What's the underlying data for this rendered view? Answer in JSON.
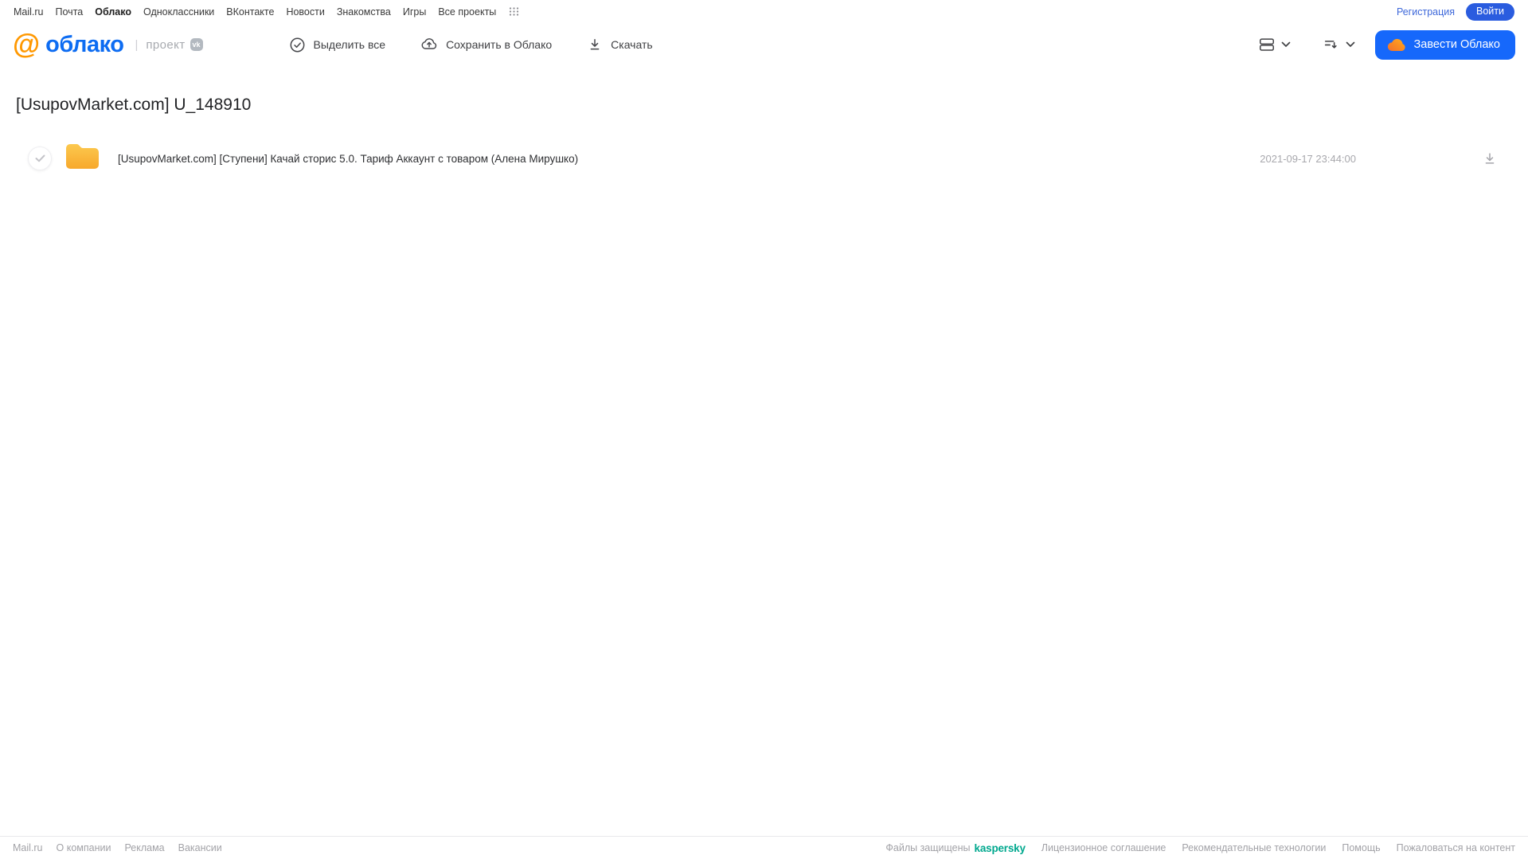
{
  "colors": {
    "brand_orange": "#ff9800",
    "brand_blue": "#0d6cf2",
    "accent_blue": "#1668fb",
    "login_blue": "#2a5cdf",
    "kaspersky_green": "#00a88e",
    "folder_yellow_top": "#fcc94f",
    "folder_yellow_bottom": "#f7a82c"
  },
  "topnav": {
    "items": [
      "Mail.ru",
      "Почта",
      "Облако",
      "Одноклассники",
      "ВКонтакте",
      "Новости",
      "Знакомства",
      "Игры",
      "Все проекты"
    ],
    "active_item": "Облако",
    "register": "Регистрация",
    "login": "Войти"
  },
  "appbar": {
    "logo_at": "@",
    "logo_text": "облако",
    "project_label": "проект",
    "vk_badge": "vk",
    "toolbar": {
      "select_all": "Выделить все",
      "save_to_cloud": "Сохранить в Облако",
      "download": "Скачать"
    },
    "get_cloud_button": "Завести Облако"
  },
  "main": {
    "title": "[UsupovMarket.com] U_148910",
    "files": [
      {
        "type": "folder",
        "name": "[UsupovMarket.com] [Ступени] Качай сторис 5.0. Тариф Аккаунт с товаром (Алена Мирушко)",
        "modified": "2021-09-17 23:44:00"
      }
    ]
  },
  "footer": {
    "left_links": [
      "Mail.ru",
      "О компании",
      "Реклама",
      "Вакансии"
    ],
    "protected_label": "Файлы защищены",
    "kaspersky": "kaspersky",
    "right_links": [
      "Лицензионное соглашение",
      "Рекомендательные технологии",
      "Помощь",
      "Пожаловаться на контент"
    ]
  }
}
